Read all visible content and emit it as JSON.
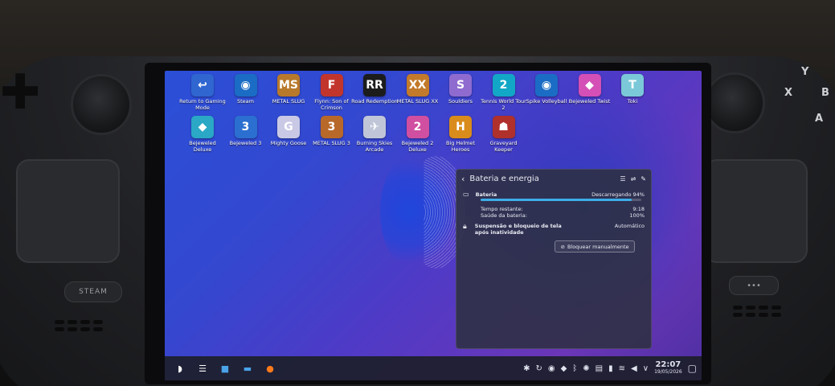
{
  "desktop_icons": [
    {
      "label": "Return to Gaming Mode",
      "icon": "return-icon",
      "color": "#2f66d0",
      "glyph": "↩"
    },
    {
      "label": "Steam",
      "icon": "steam-icon",
      "color": "#1b6cc4",
      "glyph": "◉"
    },
    {
      "label": "METAL SLUG",
      "icon": "metal-slug-icon",
      "color": "#b8792a",
      "glyph": "MS"
    },
    {
      "label": "Flynn: Son of Crimson",
      "icon": "flynn-icon",
      "color": "#c2352d",
      "glyph": "F"
    },
    {
      "label": "Road Redemption",
      "icon": "road-redemption-icon",
      "color": "#1c1c1c",
      "glyph": "RR"
    },
    {
      "label": "METAL SLUG XX",
      "icon": "metal-slug-xx-icon",
      "color": "#c37a2a",
      "glyph": "XX"
    },
    {
      "label": "Souldiers",
      "icon": "souldiers-icon",
      "color": "#8f6bd0",
      "glyph": "S"
    },
    {
      "label": "Tennis World Tour 2",
      "icon": "tennis-icon",
      "color": "#12a7c7",
      "glyph": "2"
    },
    {
      "label": "Spike Volleyball",
      "icon": "spike-icon",
      "color": "#1b6cc4",
      "glyph": "◉"
    },
    {
      "label": "Bejeweled Twist",
      "icon": "bejeweled-twist-icon",
      "color": "#d44fb6",
      "glyph": "◆"
    },
    {
      "label": "Toki",
      "icon": "toki-icon",
      "color": "#7bc9d8",
      "glyph": "T"
    },
    {
      "label": "Bejeweled Deluxe",
      "icon": "bejeweled-deluxe-icon",
      "color": "#2aa8c6",
      "glyph": "◆"
    },
    {
      "label": "Bejeweled 3",
      "icon": "bejeweled-3-icon",
      "color": "#2b6fd0",
      "glyph": "3"
    },
    {
      "label": "Mighty Goose",
      "icon": "mighty-goose-icon",
      "color": "#c9c9e6",
      "glyph": "G"
    },
    {
      "label": "METAL SLUG 3",
      "icon": "metal-slug-3-icon",
      "color": "#b8692a",
      "glyph": "3"
    },
    {
      "label": "Burning Skies Arcade",
      "icon": "burning-skies-icon",
      "color": "#c0c6d8",
      "glyph": "✈"
    },
    {
      "label": "Bejeweled 2 Deluxe",
      "icon": "bejeweled-2-icon",
      "color": "#d04fa0",
      "glyph": "2"
    },
    {
      "label": "Big Helmet Heroes",
      "icon": "big-helmet-icon",
      "color": "#d98c1b",
      "glyph": "H"
    },
    {
      "label": "Graveyard Keeper",
      "icon": "graveyard-keeper-icon",
      "color": "#b0302b",
      "glyph": "☗"
    }
  ],
  "battery_panel": {
    "title": "Bateria e energia",
    "battery_label": "Bateria",
    "battery_status": "Descarregando 94%",
    "battery_level": 0.94,
    "time_remaining_label": "Tempo restante:",
    "time_remaining_value": "9:18",
    "health_label": "Saúde da bateria:",
    "health_value": "100%",
    "suspend_label": "Suspensão e bloqueio de tela após inatividade",
    "suspend_value": "Automático",
    "lock_button": "Bloquear manualmente"
  },
  "taskbar": {
    "launchers": [
      {
        "icon": "plasma-icon",
        "glyph": "◗"
      },
      {
        "icon": "settings-icon",
        "glyph": "☰"
      },
      {
        "icon": "store-icon",
        "glyph": "■"
      },
      {
        "icon": "folder-icon",
        "glyph": "▬"
      },
      {
        "icon": "firefox-icon",
        "glyph": "●"
      }
    ],
    "tray": [
      {
        "icon": "network-icon",
        "glyph": "✱"
      },
      {
        "icon": "sync-icon",
        "glyph": "↻"
      },
      {
        "icon": "steam-tray-icon",
        "glyph": "◉"
      },
      {
        "icon": "discover-icon",
        "glyph": "◆"
      },
      {
        "icon": "bluetooth-icon",
        "glyph": "ᛒ"
      },
      {
        "icon": "brightness-icon",
        "glyph": "✺"
      },
      {
        "icon": "clipboard-icon",
        "glyph": "▤"
      },
      {
        "icon": "battery-icon",
        "glyph": "▮"
      },
      {
        "icon": "wifi-icon",
        "glyph": "≋"
      },
      {
        "icon": "volume-icon",
        "glyph": "◀"
      },
      {
        "icon": "expand-tray-icon",
        "glyph": "∨"
      }
    ],
    "clock_time": "22:07",
    "clock_date": "19/05/2026"
  },
  "device": {
    "steam_button": "STEAM",
    "menu_button": "•••",
    "face_buttons": [
      "Y",
      "X",
      "B",
      "A"
    ]
  }
}
